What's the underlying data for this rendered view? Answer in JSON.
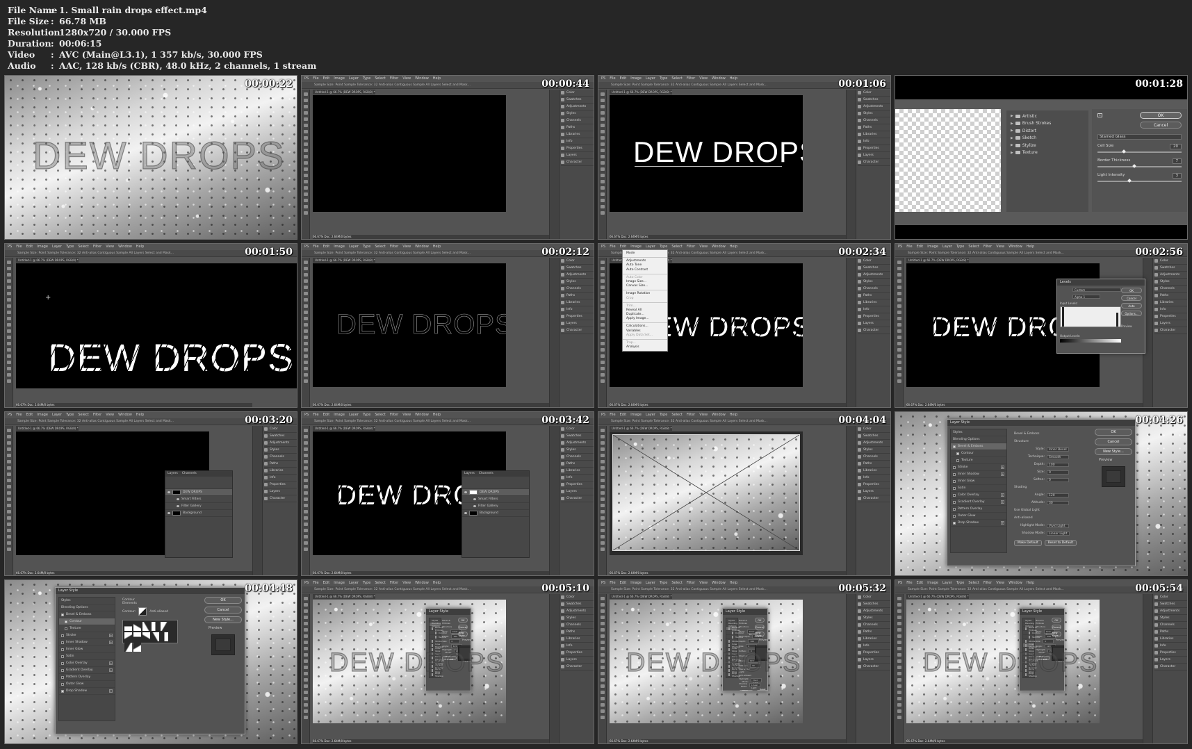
{
  "file_info": [
    {
      "label": "File Name",
      "value": "1. Small rain drops effect.mp4"
    },
    {
      "label": "File Size",
      "value": "66.78 MB"
    },
    {
      "label": "Resolution",
      "value": "1280x720 / 30.000 FPS"
    },
    {
      "label": "Duration",
      "value": "00:06:15"
    },
    {
      "label": "Video",
      "value": "AVC (Main@L3.1), 1 357 kb/s, 30.000 FPS"
    },
    {
      "label": "Audio",
      "value": "AAC, 128 kb/s (CBR), 48.0 kHz, 2 channels, 1 stream"
    }
  ],
  "separator": ":",
  "timestamps": [
    "00:00:22",
    "00:00:44",
    "00:01:06",
    "00:01:28",
    "00:01:50",
    "00:02:12",
    "00:02:34",
    "00:02:56",
    "00:03:20",
    "00:03:42",
    "00:04:04",
    "00:04:26",
    "00:04:48",
    "00:05:10",
    "00:05:32",
    "00:05:54"
  ],
  "ps": {
    "menus": [
      "PS",
      "File",
      "Edit",
      "Image",
      "Layer",
      "Type",
      "Select",
      "Filter",
      "View",
      "Window",
      "Help"
    ],
    "options": "Sample Size:  Point Sample    Tolerance: 32    Anti-alias    Contiguous    Sample All Layers      Select and Mask...",
    "doc_tab": "Untitled-1 @ 66.7% (DEW DROPS, RGB/8) *",
    "status": "66.67%    Doc: 2.64M/0 bytes",
    "panels": [
      "Color",
      "Swatches",
      "Adjustments",
      "Styles",
      "Channels",
      "Paths",
      "Libraries",
      "Info",
      "Properties",
      "Layers",
      "Character"
    ]
  },
  "dew_text": "DEW DROPS",
  "filter_gallery": {
    "categories": [
      "Artistic",
      "Brush Strokes",
      "Distort",
      "Sketch",
      "Stylize",
      "Texture"
    ],
    "ok": "OK",
    "cancel": "Cancel",
    "filter": "Stained Glass",
    "params": [
      {
        "label": "Cell Size",
        "value": "20"
      },
      {
        "label": "Border Thickness",
        "value": "7"
      },
      {
        "label": "Light Intensity",
        "value": "3"
      }
    ]
  },
  "image_menu": [
    "Mode",
    "Adjustments",
    "Auto Tone",
    "Auto Contrast",
    "Auto Color",
    "Image Size...",
    "Canvas Size...",
    "Image Rotation",
    "Crop",
    "Trim...",
    "Reveal All",
    "Duplicate...",
    "Apply Image...",
    "Calculations...",
    "Variables",
    "Apply Data Set...",
    "Trap...",
    "Analysis"
  ],
  "levels": {
    "title": "Levels",
    "preset": "Custom",
    "channel": "Alpha 1",
    "ok": "OK",
    "cancel": "Cancel",
    "auto": "Auto",
    "options": "Options...",
    "preview": "Preview",
    "input_label": "Input Levels:",
    "output_label": "Output Levels:"
  },
  "layer_style": {
    "title": "Layer Style",
    "styles": [
      "Styles",
      "Blending Options",
      "Bevel & Emboss",
      "Contour",
      "Texture",
      "Stroke",
      "Inner Shadow",
      "Inner Glow",
      "Satin",
      "Color Overlay",
      "Gradient Overlay",
      "Pattern Overlay",
      "Outer Glow",
      "Drop Shadow"
    ],
    "ok": "OK",
    "cancel": "Cancel",
    "new_style": "New Style...",
    "preview": "Preview",
    "bevel": {
      "heading": "Bevel & Emboss",
      "structure": "Structure",
      "style": "Inner Bevel",
      "technique": "Smooth",
      "depth": "100",
      "size": "0",
      "soften": "0",
      "shading": "Shading",
      "angle": "120",
      "altitude": "30",
      "global_light": "Use Global Light",
      "anti_aliased": "Anti-aliased",
      "highlight_mode": "Vivid Light",
      "shadow_mode": "Linear Light",
      "make_default": "Make Default",
      "reset_default": "Reset to Default"
    },
    "contour": {
      "heading": "Contour",
      "elements": "Elements",
      "label": "Contour:",
      "anti_aliased": "Anti-aliased"
    }
  },
  "layers": {
    "tabs": [
      "Layers",
      "Channels"
    ],
    "items": [
      "DEW DROPS",
      "Smart Filters",
      "Filter Gallery",
      "Background"
    ]
  }
}
